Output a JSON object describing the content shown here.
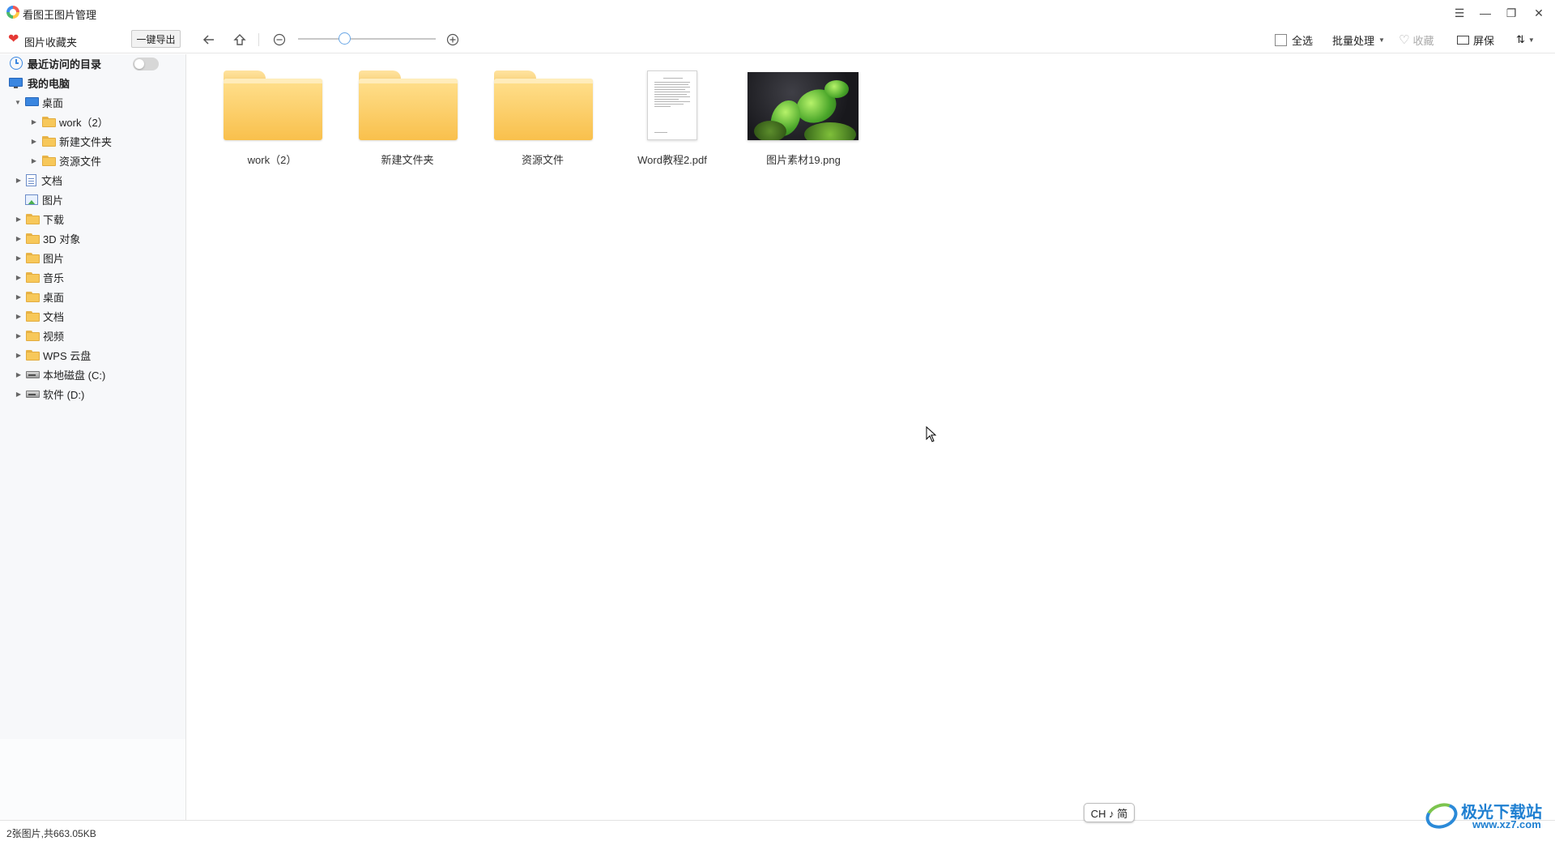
{
  "app": {
    "title": "看图王图片管理"
  },
  "window_controls": {
    "menu": "☰",
    "minimize": "—",
    "restore": "❐",
    "close": "✕"
  },
  "toolbar": {
    "favorites_label": "图片收藏夹",
    "export_label": "一键导出",
    "select_all_label": "全选",
    "batch_label": "批量处理",
    "collect_label": "收藏",
    "screensaver_label": "屏保",
    "sort_label": "⇅",
    "zoom_level": 0.35
  },
  "sidebar": {
    "recent_label": "最近访问的目录",
    "my_computer_label": "我的电脑",
    "desktop": {
      "label": "桌面",
      "children": [
        "work（2）",
        "新建文件夹",
        "资源文件"
      ]
    },
    "items": [
      "文档",
      "图片",
      "下载",
      "3D 对象",
      "图片",
      "音乐",
      "桌面",
      "文档",
      "视频",
      "WPS 云盘",
      "本地磁盘 (C:)",
      "软件 (D:)"
    ]
  },
  "files": [
    {
      "name": "work（2）",
      "type": "folder"
    },
    {
      "name": "新建文件夹",
      "type": "folder"
    },
    {
      "name": "资源文件",
      "type": "folder"
    },
    {
      "name": "Word教程2.pdf",
      "type": "pdf"
    },
    {
      "name": "图片素材19.png",
      "type": "image"
    }
  ],
  "status": {
    "text": "2张图片,共663.05KB"
  },
  "ime": {
    "text": "CH ♪ 简"
  },
  "watermark": {
    "title": "极光下载站",
    "url": "www.xz7.com"
  },
  "colors": {
    "accent": "#3a86e0",
    "folder": "#f9c04c",
    "heart": "#e53935"
  }
}
